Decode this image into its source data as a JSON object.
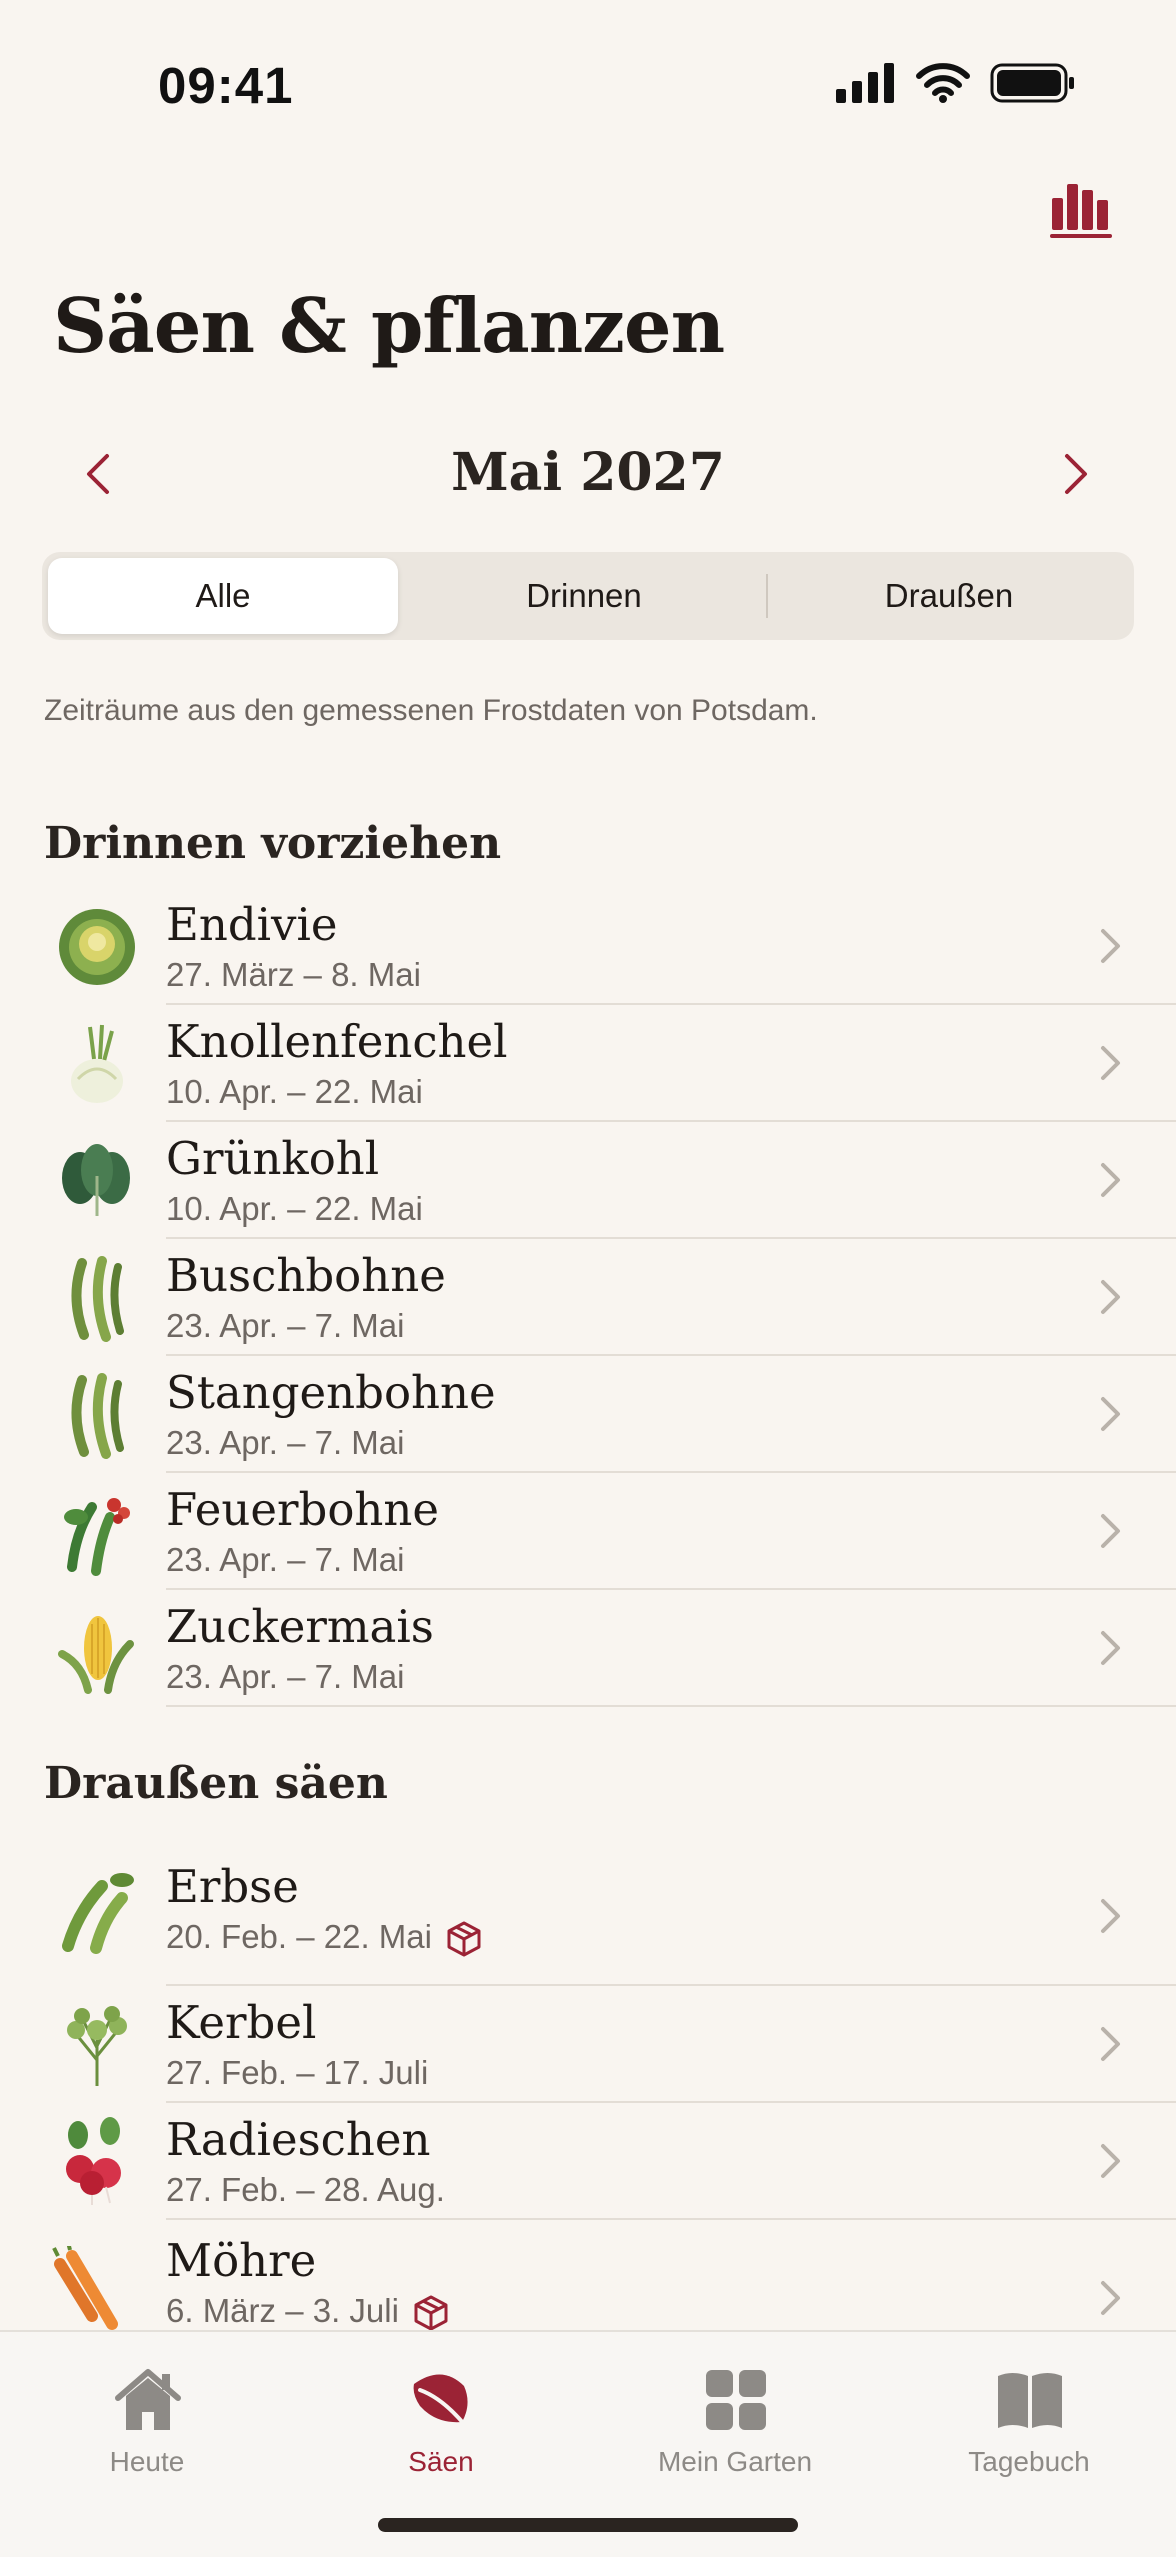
{
  "status_bar": {
    "time": "09:41"
  },
  "page": {
    "title": "Säen & pflanzen",
    "month": "Mai 2027",
    "hint": "Zeiträume aus den gemessenen Frostdaten von Potsdam."
  },
  "filter": {
    "segments": [
      "Alle",
      "Drinnen",
      "Draußen"
    ],
    "selected": "Alle"
  },
  "sections": [
    {
      "title": "Drinnen vorziehen",
      "items": [
        {
          "name": "Endivie",
          "dates": "27. März – 8. Mai",
          "icon": "endive-icon"
        },
        {
          "name": "Knollenfenchel",
          "dates": "10. Apr. – 22. Mai",
          "icon": "fennel-icon"
        },
        {
          "name": "Grünkohl",
          "dates": "10. Apr. – 22. Mai",
          "icon": "kale-icon"
        },
        {
          "name": "Buschbohne",
          "dates": "23. Apr. – 7. Mai",
          "icon": "bean-icon"
        },
        {
          "name": "Stangenbohne",
          "dates": "23. Apr. – 7. Mai",
          "icon": "bean-icon"
        },
        {
          "name": "Feuerbohne",
          "dates": "23. Apr. – 7. Mai",
          "icon": "runner-bean-icon"
        },
        {
          "name": "Zuckermais",
          "dates": "23. Apr. – 7. Mai",
          "icon": "corn-icon"
        }
      ]
    },
    {
      "title": "Draußen säen",
      "items": [
        {
          "name": "Erbse",
          "dates": "20. Feb. – 22. Mai",
          "icon": "pea-icon",
          "badge": "box-icon"
        },
        {
          "name": "Kerbel",
          "dates": "27. Feb. – 17. Juli",
          "icon": "chervil-icon"
        },
        {
          "name": "Radieschen",
          "dates": "27. Feb. – 28. Aug.",
          "icon": "radish-icon"
        },
        {
          "name": "Möhre",
          "dates": "6. März – 3. Juli",
          "icon": "carrot-icon",
          "badge": "box-icon"
        }
      ]
    }
  ],
  "tabs": [
    {
      "label": "Heute",
      "icon": "house-icon"
    },
    {
      "label": "Säen",
      "icon": "leaf-icon",
      "active": true
    },
    {
      "label": "Mein Garten",
      "icon": "grid-icon"
    },
    {
      "label": "Tagebuch",
      "icon": "book-icon"
    }
  ],
  "colors": {
    "accent": "#9b2335",
    "background": "#f9f5f0",
    "muted_text": "#6e6762"
  }
}
